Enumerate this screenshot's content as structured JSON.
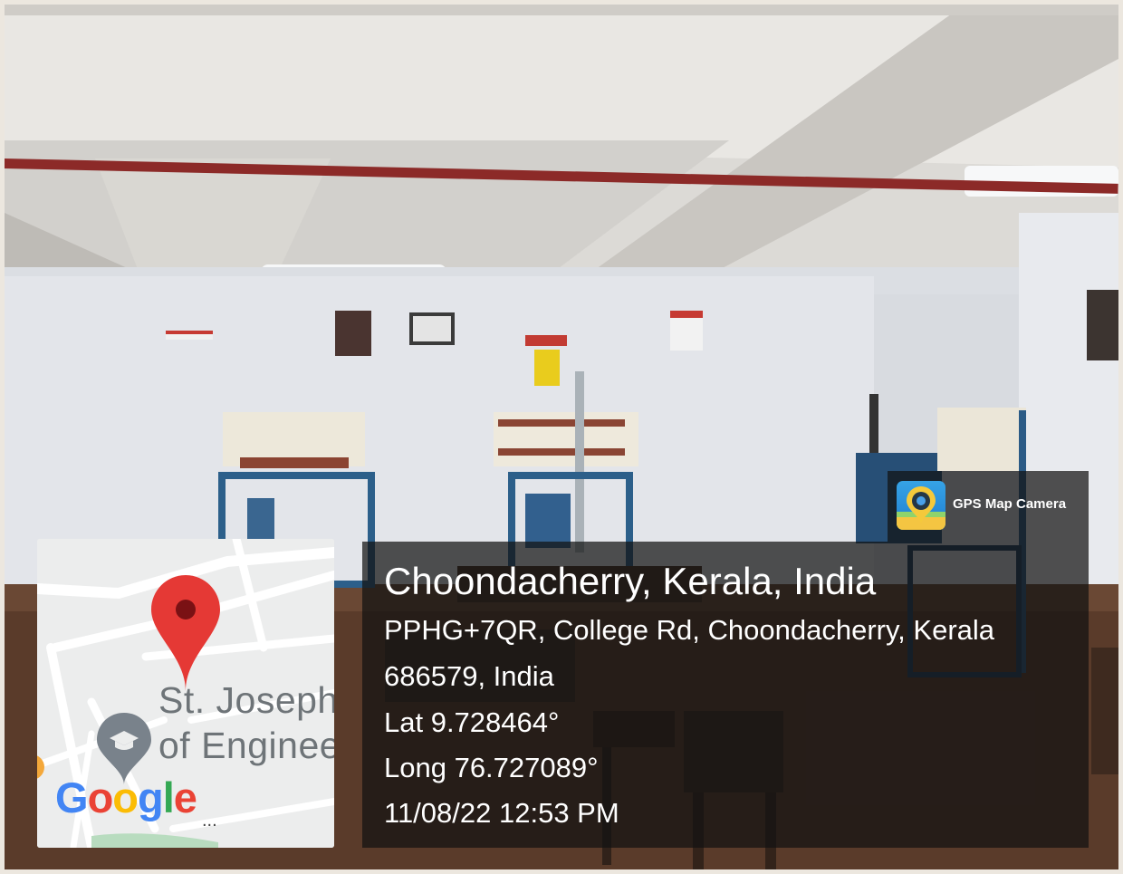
{
  "map": {
    "place_line1": "St. Joseph",
    "place_line2": "of Enginee",
    "google_text": "Google",
    "google_letters": [
      {
        "ch": "G",
        "color": "#4285F4"
      },
      {
        "ch": "o",
        "color": "#EA4335"
      },
      {
        "ch": "o",
        "color": "#FBBC05"
      },
      {
        "ch": "g",
        "color": "#4285F4"
      },
      {
        "ch": "l",
        "color": "#34A853"
      },
      {
        "ch": "e",
        "color": "#EA4335"
      }
    ],
    "more": "...",
    "pin_icon": "map-pin-icon",
    "school_icon": "graduation-cap-icon",
    "pin_color": "#e53935"
  },
  "app": {
    "name": "GPS Map Camera",
    "icon": "gps-map-camera-icon"
  },
  "location": {
    "title": "Choondacherry, Kerala, India",
    "address_line1": "PPHG+7QR, College Rd, Choondacherry, Kerala",
    "address_line2": "686579, India",
    "lat": "Lat 9.728464°",
    "long": "Long 76.727089°",
    "datetime": "11/08/22 12:53 PM"
  }
}
